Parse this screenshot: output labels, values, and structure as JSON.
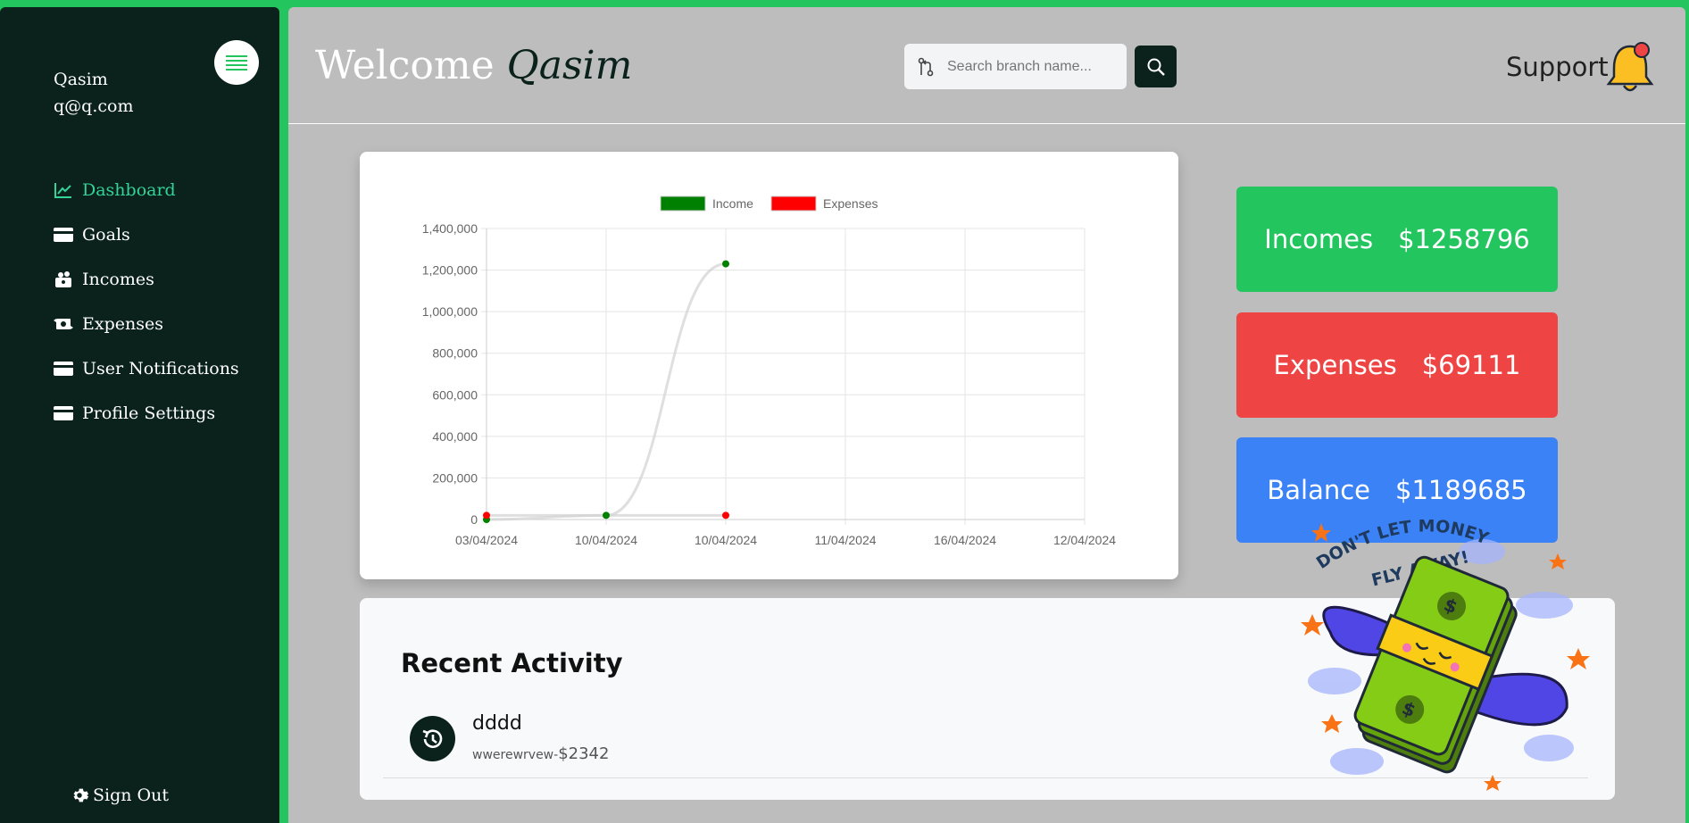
{
  "sidebar": {
    "user_name": "Qasim",
    "user_email": "q@q.com",
    "items": [
      {
        "label": "Dashboard",
        "icon": "chart-line-icon",
        "active": true
      },
      {
        "label": "Goals",
        "icon": "credit-card-icon"
      },
      {
        "label": "Incomes",
        "icon": "money-bag-icon"
      },
      {
        "label": "Expenses",
        "icon": "money-transfer-icon"
      },
      {
        "label": "User Notifications",
        "icon": "credit-card-icon"
      },
      {
        "label": "Profile Settings",
        "icon": "credit-card-icon"
      }
    ],
    "sign_out": "Sign Out"
  },
  "header": {
    "welcome": "Welcome",
    "name": "Qasim",
    "search_placeholder": "Search branch name...",
    "support": "Support"
  },
  "stats": {
    "incomes_label": "Incomes",
    "incomes_value": "$1258796",
    "expenses_label": "Expenses",
    "expenses_value": "$69111",
    "balance_label": "Balance",
    "balance_value": "$1189685"
  },
  "activity": {
    "title": "Recent Activity",
    "items": [
      {
        "title": "dddd",
        "desc": "wwerewrvew-",
        "amount": "$2342"
      }
    ]
  },
  "sticker": {
    "text_line1": "DON'T LET MONEY",
    "text_line2": "FLY AWAY!"
  },
  "colors": {
    "sidebar_bg": "#0a221b",
    "accent": "#22c55e",
    "expense": "#ef4444",
    "balance": "#3b82f6",
    "main_bg": "#bdbdbd"
  },
  "chart_data": {
    "type": "line",
    "categories": [
      "03/04/2024",
      "10/04/2024",
      "10/04/2024",
      "11/04/2024",
      "16/04/2024",
      "12/04/2024"
    ],
    "series": [
      {
        "name": "Income",
        "color": "#008000",
        "values": [
          0,
          20000,
          1230000
        ]
      },
      {
        "name": "Expenses",
        "color": "#ff0000",
        "values": [
          20000,
          null,
          20000
        ]
      }
    ],
    "yticks": [
      "0",
      "200,000",
      "400,000",
      "600,000",
      "800,000",
      "1,000,000",
      "1,200,000",
      "1,400,000"
    ],
    "ylim": [
      0,
      1400000
    ],
    "grid": true,
    "legend": "top"
  }
}
